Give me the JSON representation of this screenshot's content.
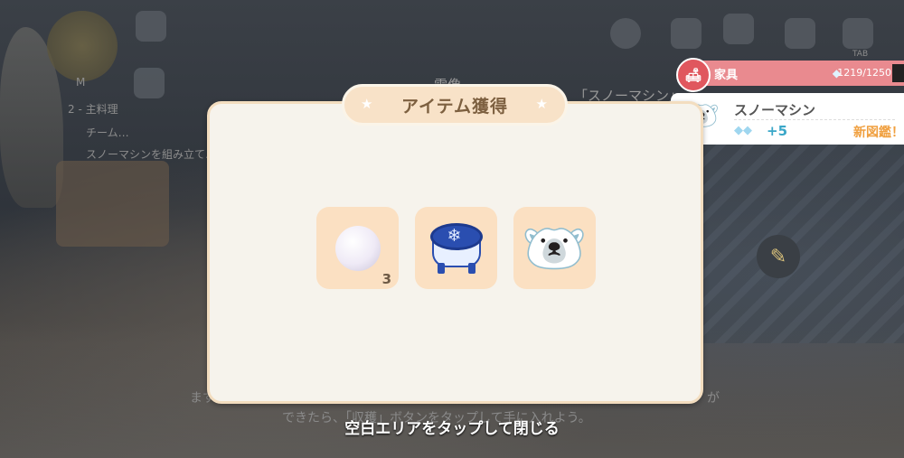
{
  "background": {
    "quest_title": "雪像",
    "quest_banner": "「スノーマシン」",
    "sidebar_lines": [
      "2 - 主料理",
      "チーム…",
      "スノーマシンを組み立て…"
    ],
    "tutorial_line1": "ます",
    "tutorial_line2_suffix": "が",
    "tutorial_line3": "できたら、「収穫」ボタンをタップして手に入れよう。",
    "minimap_label": "M",
    "tab_label": "TAB"
  },
  "notification": {
    "category": "家具",
    "count": "1219/1250",
    "item_name": "スノーマシン",
    "gain": "+5",
    "new_entry": "新図鑑！",
    "colors": {
      "bar": "#e98a8f",
      "badge": "#e0575e",
      "gain": "#3aa7c8",
      "new": "#f0a040"
    }
  },
  "modal": {
    "title": "アイテム獲得",
    "items": [
      {
        "icon": "snowball-icon",
        "quantity": "3"
      },
      {
        "icon": "snowflake-stool-icon",
        "quantity": ""
      },
      {
        "icon": "polar-bear-figure-icon",
        "quantity": ""
      }
    ],
    "close_hint": "空白エリアをタップして閉じる",
    "colors": {
      "panel": "#f6f3ec",
      "slot": "#fbe0c2",
      "title_bg": "#f8e2c8",
      "title_text": "#7d6040"
    }
  }
}
